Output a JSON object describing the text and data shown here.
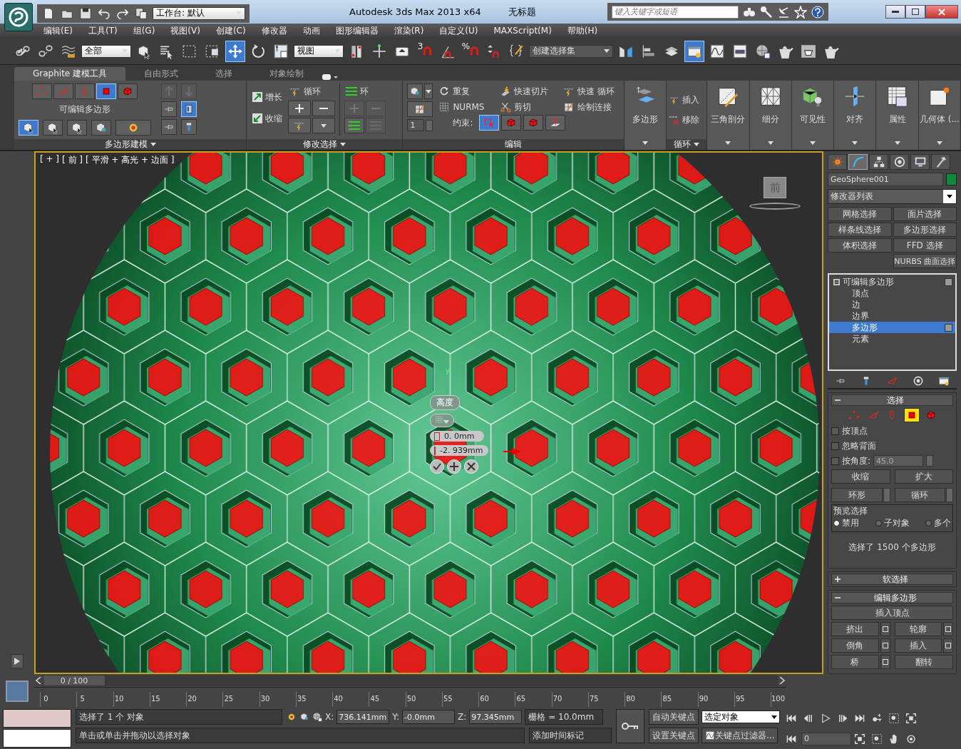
{
  "title_bar": {
    "workspace": "工作台: 默认",
    "title": "Autodesk 3ds Max  2013 x64",
    "document": "无标题",
    "search": {
      "placeholder": "键入关键字或短语"
    }
  },
  "menu": [
    "编辑(E)",
    "工具(T)",
    "组(G)",
    "视图(V)",
    "创建(C)",
    "修改器",
    "动画",
    "图形编辑器",
    "渲染(R)",
    "自定义(U)",
    "MAXScript(M)",
    "帮助(H)"
  ],
  "toolbar": [
    {
      "kind": "chain",
      "selected": false
    },
    {
      "kind": "broken-chain",
      "selected": false
    },
    {
      "kind": "waves",
      "selected": false
    },
    {
      "kind": "dropdown",
      "value": "全部"
    },
    {
      "kind": "cube-cursor",
      "selected": false
    },
    {
      "kind": "list-cursor",
      "selected": false
    },
    {
      "kind": "dashed-rectangle",
      "selected": false
    },
    {
      "kind": "dashed-cube",
      "selected": false
    },
    {
      "kind": "move-arrows",
      "selected": true
    },
    {
      "kind": "rotate-arrow",
      "selected": false
    },
    {
      "kind": "scale-box",
      "selected": false
    },
    {
      "kind": "dropdown",
      "value": "视图"
    },
    {
      "kind": "pivot",
      "selected": false
    },
    {
      "kind": "crosshair",
      "selected": false
    },
    {
      "kind": "keyboard",
      "selected": false
    },
    {
      "kind": "magnet",
      "label": "3",
      "selected": false
    },
    {
      "kind": "angle-magnet",
      "selected": false
    },
    {
      "kind": "magnet",
      "label": "%",
      "selected": false
    },
    {
      "kind": "spinner-magnet",
      "selected": false
    },
    {
      "kind": "braces",
      "selected": false
    },
    {
      "kind": "dropdown",
      "value": "创建选择集"
    },
    {
      "kind": "mirror",
      "selected": false
    },
    {
      "kind": "align-bars",
      "selected": false
    },
    {
      "kind": "layers",
      "selected": false
    },
    {
      "kind": "explorer-window",
      "selected": true
    },
    {
      "kind": "curve-graph",
      "selected": false
    },
    {
      "kind": "schematic",
      "selected": false
    },
    {
      "kind": "checker-sphere",
      "selected": false
    },
    {
      "kind": "teapot",
      "selected": false
    },
    {
      "kind": "teapot-frame",
      "selected": false
    },
    {
      "kind": "teapot",
      "selected": false
    }
  ],
  "ribbon": {
    "tabs": [
      {
        "label": "Graphite 建模工具",
        "selected": true
      },
      {
        "label": "自由形式",
        "selected": false
      },
      {
        "label": "选择",
        "selected": false
      },
      {
        "label": "对象绘制",
        "selected": false
      }
    ],
    "polygon_modeling": {
      "subobjects": [
        {
          "kind": "dots",
          "selected": false
        },
        {
          "kind": "triangle",
          "selected": false
        },
        {
          "kind": "outline",
          "selected": false
        },
        {
          "kind": "square",
          "selected": true
        },
        {
          "kind": "cube",
          "selected": false
        }
      ],
      "object_label": "可编辑多边形",
      "tools": [
        {
          "kind": "cube-cursor",
          "selected": true
        },
        {
          "kind": "cube-cursor",
          "selected": false
        },
        {
          "kind": "cube-cursor",
          "selected": false
        },
        {
          "kind": "cube-lens",
          "selected": false
        },
        {
          "kind": "gradient-dot",
          "selected": false
        }
      ],
      "side_tools": [
        {
          "kind": "up-arrow",
          "selected": false,
          "disabled": true
        },
        {
          "kind": "down-arrow",
          "selected": false,
          "disabled": true
        },
        {
          "kind": "pin",
          "selected": false,
          "disabled": false
        },
        {
          "kind": "panel",
          "selected": true,
          "disabled": false
        },
        {
          "kind": "pin",
          "selected": false,
          "disabled": false
        },
        {
          "kind": "tube",
          "selected": false,
          "disabled": false
        }
      ],
      "footer": "多边形建模"
    },
    "modify_selection": {
      "grow": "增长",
      "shrink": "收缩",
      "loop": "循环",
      "ring": "环",
      "footer": "修改选择"
    },
    "edit": {
      "items": [
        {
          "kind": "repeat",
          "label": "重复"
        },
        {
          "kind": "slice",
          "label": "快速切片"
        },
        {
          "kind": "loop",
          "label": "快速 循环"
        },
        {
          "kind": "grid",
          "label": "NURMS"
        },
        {
          "kind": "scissors",
          "label": "剪切"
        },
        {
          "kind": "connect",
          "label": "绘制连接"
        }
      ],
      "spinner": "1",
      "constraint_label": "约束:",
      "constraints": [
        {
          "kind": "cross-square",
          "selected": true
        },
        {
          "kind": "cube",
          "selected": false
        },
        {
          "kind": "cube",
          "selected": false
        },
        {
          "kind": "normal",
          "selected": false
        }
      ],
      "footer": "编辑"
    },
    "big_buttons": [
      {
        "kind": "planes",
        "label": "多边形"
      },
      {
        "kind": "loop-group",
        "insert": "插入",
        "remove": "移除",
        "footer": "循环"
      },
      {
        "kind": "triangle-pen",
        "label": "三角剖分"
      },
      {
        "kind": "mesh",
        "label": "细分"
      },
      {
        "kind": "bulb-cube",
        "label": "可见性"
      },
      {
        "kind": "plane-arrow",
        "label": "对齐"
      },
      {
        "kind": "table",
        "label": "属性"
      },
      {
        "kind": "spark-rect",
        "label": "几何体 (..."
      }
    ]
  },
  "viewport": {
    "labels": [
      "[ + ]",
      "[ 前 ]",
      "[ 平滑 + 高光 + 边面 ]"
    ],
    "view_cube": "前",
    "axis_label": "y",
    "caddy": {
      "title": "高度",
      "values": [
        "0. 0mm",
        "-2. 939mm"
      ]
    }
  },
  "command_panel": {
    "tabs": [
      {
        "kind": "sun",
        "selected": false
      },
      {
        "kind": "arc",
        "selected": true
      },
      {
        "kind": "hierarchy",
        "selected": false
      },
      {
        "kind": "disc",
        "selected": false
      },
      {
        "kind": "monitor",
        "selected": false
      },
      {
        "kind": "hammer",
        "selected": false
      }
    ],
    "object_name": "GeoSphere001",
    "modifier_list": "修改器列表",
    "modifier_buttons": [
      "网格选择",
      "面片选择",
      "样条线选择",
      "多边形选择",
      "体积选择",
      "FFD 选择",
      "NURBS 曲面选择"
    ],
    "stack": [
      {
        "label": "可编辑多边形",
        "expanded": true,
        "selected": false,
        "children": [
          {
            "label": "顶点",
            "selected": false
          },
          {
            "label": "边",
            "selected": false
          },
          {
            "label": "边界",
            "selected": false
          },
          {
            "label": "多边形",
            "selected": true
          },
          {
            "label": "元素",
            "selected": false
          }
        ]
      }
    ],
    "selection": {
      "title": "选择",
      "expanded": true,
      "levels": [
        {
          "kind": "dots",
          "selected": false
        },
        {
          "kind": "triangle",
          "selected": false
        },
        {
          "kind": "outline",
          "selected": false
        },
        {
          "kind": "square",
          "selected": true
        },
        {
          "kind": "cube",
          "selected": false
        }
      ],
      "checks": [
        {
          "label": "按顶点",
          "checked": false
        },
        {
          "label": "忽略背面",
          "checked": false
        },
        {
          "label": "按角度:",
          "checked": false
        }
      ],
      "angle": "45.0",
      "buttons": [
        {
          "label": "收缩",
          "kind": "plain"
        },
        {
          "label": "扩大",
          "kind": "plain"
        },
        {
          "label": "环形",
          "kind": "spinner"
        },
        {
          "label": "循环",
          "kind": "spinner"
        }
      ],
      "preview_title": "预览选择",
      "preview": [
        {
          "label": "禁用",
          "selected": true
        },
        {
          "label": "子对象",
          "selected": false
        },
        {
          "label": "多个",
          "selected": false
        }
      ],
      "status": "选择了 1500 个多边形"
    },
    "soft_selection": {
      "title": "软选择",
      "expanded": false
    },
    "edit_polygons": {
      "title": "编辑多边形",
      "expanded": true,
      "top": "插入顶点",
      "buttons": [
        {
          "label": "挤出",
          "settings": true
        },
        {
          "label": "轮廓",
          "settings": true
        },
        {
          "label": "倒角",
          "settings": true
        },
        {
          "label": "插入",
          "settings": true
        },
        {
          "label": "桥",
          "settings": true
        },
        {
          "label": "翻转",
          "settings": false
        }
      ]
    }
  },
  "timeline": {
    "slider": {
      "label": "0 / 100",
      "level": 0
    },
    "ticks": [
      "0",
      "5",
      "10",
      "15",
      "20",
      "25",
      "30",
      "35",
      "40",
      "45",
      "50",
      "55",
      "60",
      "65",
      "70",
      "75",
      "80",
      "85",
      "90",
      "95",
      "100"
    ]
  },
  "status_bar": {
    "selection": "选择了 1 个 对象",
    "prompt": "单击或单击并拖动以选择对象",
    "coords": [
      {
        "label": "X:",
        "value": "736.141mm"
      },
      {
        "label": "Y:",
        "value": "-0.0mm"
      },
      {
        "label": "Z:",
        "value": "97.345mm"
      }
    ],
    "grid": "栅格 = 10.0mm",
    "time_tag": "添加时间标记",
    "auto_key": "自动关键点",
    "set_key": "设置关键点",
    "key_mode": "选定对象",
    "key_filters": "关键点过滤器...",
    "frame": "0"
  }
}
